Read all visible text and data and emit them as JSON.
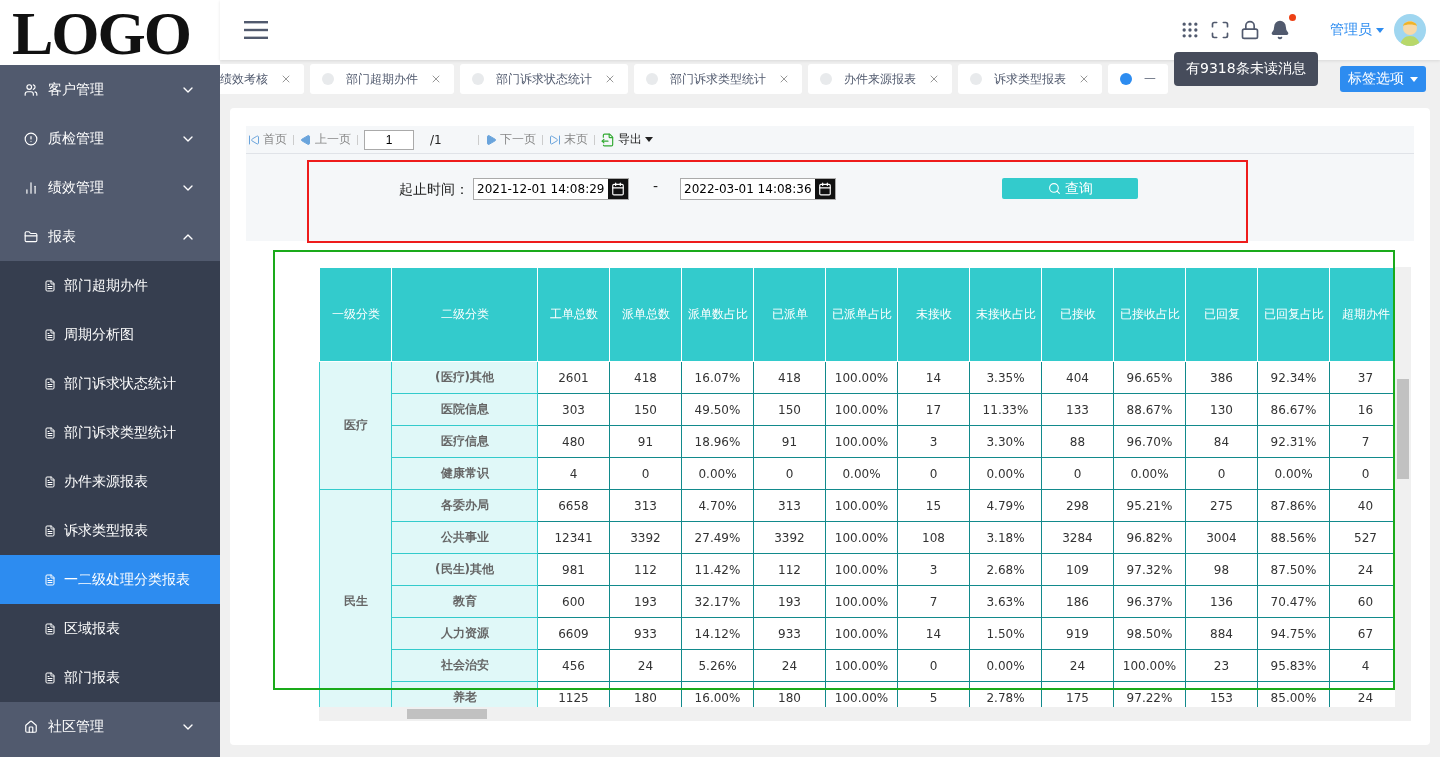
{
  "logo": "LOGO",
  "sidebar": {
    "items": [
      {
        "label": "客户管理",
        "expanded": false
      },
      {
        "label": "质检管理",
        "expanded": false
      },
      {
        "label": "绩效管理",
        "expanded": false
      },
      {
        "label": "报表",
        "expanded": true,
        "children": [
          {
            "label": "部门超期办件",
            "selected": false
          },
          {
            "label": "周期分析图",
            "selected": false
          },
          {
            "label": "部门诉求状态统计",
            "selected": false
          },
          {
            "label": "部门诉求类型统计",
            "selected": false
          },
          {
            "label": "办件来源报表",
            "selected": false
          },
          {
            "label": "诉求类型报表",
            "selected": false
          },
          {
            "label": "一二级处理分类报表",
            "selected": true
          },
          {
            "label": "区域报表",
            "selected": false
          },
          {
            "label": "部门报表",
            "selected": false
          }
        ]
      },
      {
        "label": "社区管理",
        "expanded": false
      }
    ]
  },
  "header": {
    "user": "管理员",
    "notification_tooltip": "有9318条未读消息",
    "has_unread": true
  },
  "tabs": [
    {
      "label": "绩效考核",
      "selected": false
    },
    {
      "label": "部门超期办件",
      "selected": false
    },
    {
      "label": "部门诉求状态统计",
      "selected": false
    },
    {
      "label": "部门诉求类型统计",
      "selected": false
    },
    {
      "label": "办件来源报表",
      "selected": false
    },
    {
      "label": "诉求类型报表",
      "selected": false
    },
    {
      "label": "一",
      "selected": true
    }
  ],
  "tab_options": "标签选项",
  "pager": {
    "first": "首页",
    "prev": "上一页",
    "page": "1",
    "total": "/1",
    "next": "下一页",
    "last": "末页",
    "export": "导出"
  },
  "filter": {
    "label": "起止时间：",
    "start": "2021-12-01 14:08:29",
    "separator": "-",
    "end": "2022-03-01 14:08:36",
    "query": "查询"
  },
  "table": {
    "columns": [
      "一级分类",
      "二级分类",
      "工单总数",
      "派单总数",
      "派单数占比",
      "已派单",
      "已派单占比",
      "未接收",
      "未接收占比",
      "已接收",
      "已接收占比",
      "已回复",
      "已回复占比",
      "超期办件"
    ],
    "groups": [
      {
        "name": "医疗",
        "rows": [
          {
            "name": "(医疗)其他",
            "cells": [
              "2601",
              "418",
              "16.07%",
              "418",
              "100.00%",
              "14",
              "3.35%",
              "404",
              "96.65%",
              "386",
              "92.34%",
              "37"
            ]
          },
          {
            "name": "医院信息",
            "cells": [
              "303",
              "150",
              "49.50%",
              "150",
              "100.00%",
              "17",
              "11.33%",
              "133",
              "88.67%",
              "130",
              "86.67%",
              "16"
            ]
          },
          {
            "name": "医疗信息",
            "cells": [
              "480",
              "91",
              "18.96%",
              "91",
              "100.00%",
              "3",
              "3.30%",
              "88",
              "96.70%",
              "84",
              "92.31%",
              "7"
            ]
          },
          {
            "name": "健康常识",
            "cells": [
              "4",
              "0",
              "0.00%",
              "0",
              "0.00%",
              "0",
              "0.00%",
              "0",
              "0.00%",
              "0",
              "0.00%",
              "0"
            ]
          }
        ]
      },
      {
        "name": "民生",
        "rows": [
          {
            "name": "各委办局",
            "cells": [
              "6658",
              "313",
              "4.70%",
              "313",
              "100.00%",
              "15",
              "4.79%",
              "298",
              "95.21%",
              "275",
              "87.86%",
              "40"
            ]
          },
          {
            "name": "公共事业",
            "cells": [
              "12341",
              "3392",
              "27.49%",
              "3392",
              "100.00%",
              "108",
              "3.18%",
              "3284",
              "96.82%",
              "3004",
              "88.56%",
              "527"
            ]
          },
          {
            "name": "(民生)其他",
            "cells": [
              "981",
              "112",
              "11.42%",
              "112",
              "100.00%",
              "3",
              "2.68%",
              "109",
              "97.32%",
              "98",
              "87.50%",
              "24"
            ]
          },
          {
            "name": "教育",
            "cells": [
              "600",
              "193",
              "32.17%",
              "193",
              "100.00%",
              "7",
              "3.63%",
              "186",
              "96.37%",
              "136",
              "70.47%",
              "60"
            ]
          },
          {
            "name": "人力资源",
            "cells": [
              "6609",
              "933",
              "14.12%",
              "933",
              "100.00%",
              "14",
              "1.50%",
              "919",
              "98.50%",
              "884",
              "94.75%",
              "67"
            ]
          },
          {
            "name": "社会治安",
            "cells": [
              "456",
              "24",
              "5.26%",
              "24",
              "100.00%",
              "0",
              "0.00%",
              "24",
              "100.00%",
              "23",
              "95.83%",
              "4"
            ]
          },
          {
            "name": "养老",
            "cells": [
              "1125",
              "180",
              "16.00%",
              "180",
              "100.00%",
              "5",
              "2.78%",
              "175",
              "97.22%",
              "153",
              "85.00%",
              "24"
            ]
          }
        ]
      }
    ]
  }
}
